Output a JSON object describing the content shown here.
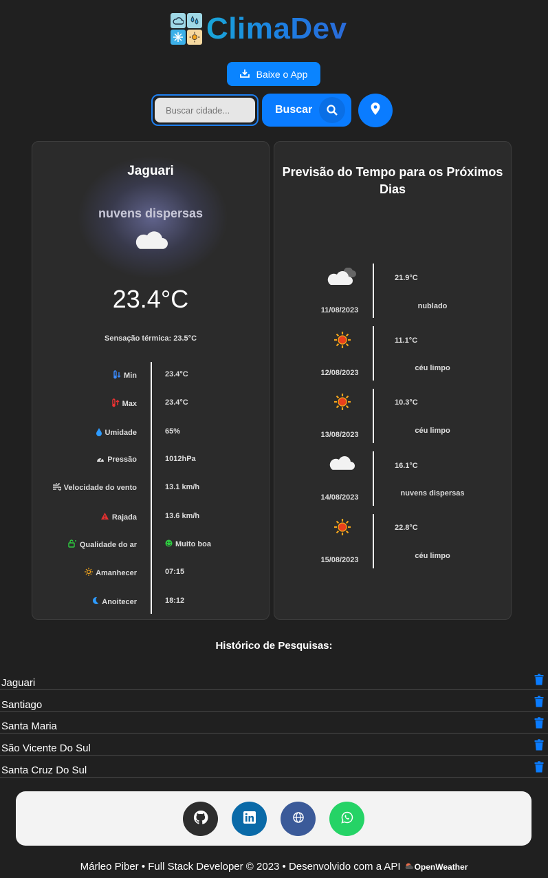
{
  "brand": {
    "name": "ClimaDev"
  },
  "header": {
    "app_button": "Baixe o App",
    "search_placeholder": "Buscar cidade...",
    "search_button": "Buscar"
  },
  "current": {
    "city": "Jaguari",
    "description": "nuvens dispersas",
    "temperature": "23.4°C",
    "feels_like": "Sensação térmica: 23.5°C",
    "stats": [
      {
        "label": "Min",
        "value": "23.4°C",
        "icon": "thermometer-low-icon"
      },
      {
        "label": "Max",
        "value": "23.4°C",
        "icon": "thermometer-high-icon"
      },
      {
        "label": "Umidade",
        "value": "65%",
        "icon": "droplet-icon"
      },
      {
        "label": "Pressão",
        "value": "1012hPa",
        "icon": "gauge-icon"
      },
      {
        "label": "Velocidade do vento",
        "value": "13.1 km/h",
        "icon": "wind-icon"
      },
      {
        "label": "Rajada",
        "value": "13.6 km/h",
        "icon": "warning-icon"
      },
      {
        "label": "Qualidade do ar",
        "value": "Muito boa",
        "icon": "air-quality-icon"
      },
      {
        "label": "Amanhecer",
        "value": "07:15",
        "icon": "sunrise-icon"
      },
      {
        "label": "Anoitecer",
        "value": "18:12",
        "icon": "moon-icon"
      }
    ]
  },
  "forecast": {
    "title": "Previsão do Tempo para os Próximos Dias",
    "days": [
      {
        "date": "11/08/2023",
        "temp": "21.9°C",
        "desc": "nublado",
        "icon": "cloudy-icon"
      },
      {
        "date": "12/08/2023",
        "temp": "11.1°C",
        "desc": "céu limpo",
        "icon": "sun-icon"
      },
      {
        "date": "13/08/2023",
        "temp": "10.3°C",
        "desc": "céu limpo",
        "icon": "sun-icon"
      },
      {
        "date": "14/08/2023",
        "temp": "16.1°C",
        "desc": "nuvens dispersas",
        "icon": "cloud-icon"
      },
      {
        "date": "15/08/2023",
        "temp": "22.8°C",
        "desc": "céu limpo",
        "icon": "sun-icon"
      }
    ]
  },
  "history": {
    "title": "Histórico de Pesquisas:",
    "items": [
      "Jaguari",
      "Santiago",
      "Santa Maria",
      "São Vicente Do Sul",
      "Santa Cruz Do Sul"
    ]
  },
  "footer": {
    "copyright": "Márleo Piber • Full Stack Developer © 2023 • Desenvolvido com a API",
    "api_brand": "OpenWeather"
  },
  "colors": {
    "accent": "#0a7cff",
    "background": "#202020",
    "card": "#2b2b2b"
  }
}
